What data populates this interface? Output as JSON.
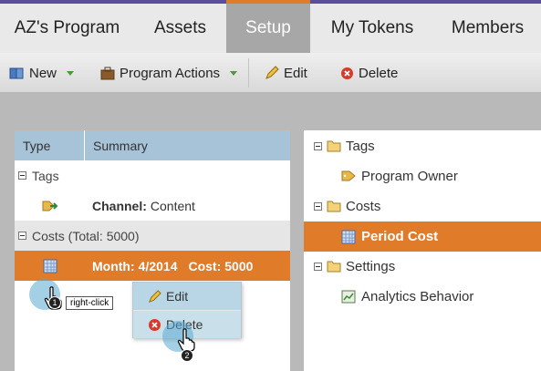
{
  "tabs": [
    {
      "label": "AZ's Program",
      "active": false
    },
    {
      "label": "Assets",
      "active": false
    },
    {
      "label": "Setup",
      "active": true
    },
    {
      "label": "My Tokens",
      "active": false
    },
    {
      "label": "Members",
      "active": false
    }
  ],
  "toolbar": {
    "new_label": "New",
    "program_actions_label": "Program Actions",
    "edit_label": "Edit",
    "delete_label": "Delete"
  },
  "left_panel": {
    "headers": {
      "type": "Type",
      "summary": "Summary"
    },
    "tags_group": {
      "label": "Tags",
      "icon": "tag-arrow-icon",
      "channel_key": "Channel:",
      "channel_value": "Content"
    },
    "costs_group": {
      "label": "Costs (Total: 5000)",
      "icon": "calendar-grid-icon",
      "month_key": "Month:",
      "month_value": "4/2014",
      "cost_key": "Cost:",
      "cost_value": "5000"
    }
  },
  "context_menu": {
    "edit_label": "Edit",
    "delete_label": "Delete"
  },
  "annotations": {
    "step1": "1",
    "step1_hint": "right-click",
    "step2": "2"
  },
  "right_panel": {
    "tags_label": "Tags",
    "program_owner_label": "Program Owner",
    "costs_label": "Costs",
    "period_cost_label": "Period Cost",
    "settings_label": "Settings",
    "analytics_label": "Analytics Behavior"
  },
  "colors": {
    "accent_orange": "#e07b2a",
    "header_blue": "#a7c3d8",
    "brand_purple": "#5a4e9a"
  }
}
